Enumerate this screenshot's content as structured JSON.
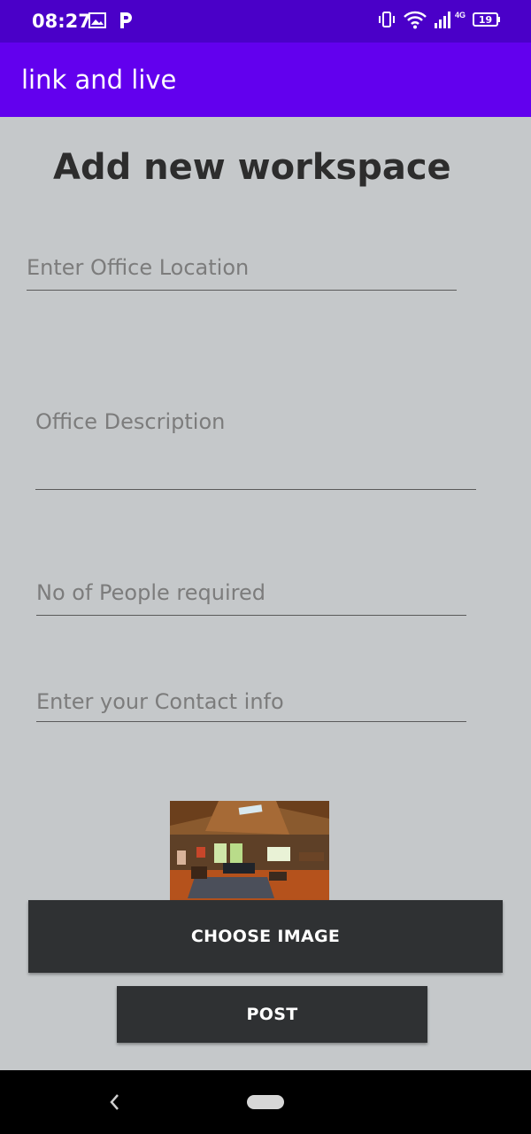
{
  "status_bar": {
    "time": "08:27",
    "network_type": "4G",
    "battery_level": "19",
    "icons": [
      "image-icon",
      "parking-app-icon",
      "vibrate-icon",
      "wifi-icon",
      "signal-icon",
      "battery-icon"
    ]
  },
  "app_bar": {
    "title": "link and live"
  },
  "page": {
    "title": "Add new workspace"
  },
  "form": {
    "location_placeholder": "Enter Office Location",
    "description_placeholder": "Office Description",
    "people_placeholder": "No of People required",
    "contact_placeholder": "Enter your Contact info"
  },
  "buttons": {
    "choose_image": "CHOOSE IMAGE",
    "post": "POST"
  },
  "colors": {
    "status_bar": "#4a00c8",
    "app_bar": "#6200ee",
    "background": "#c5c8ca",
    "button": "#2f3133"
  }
}
